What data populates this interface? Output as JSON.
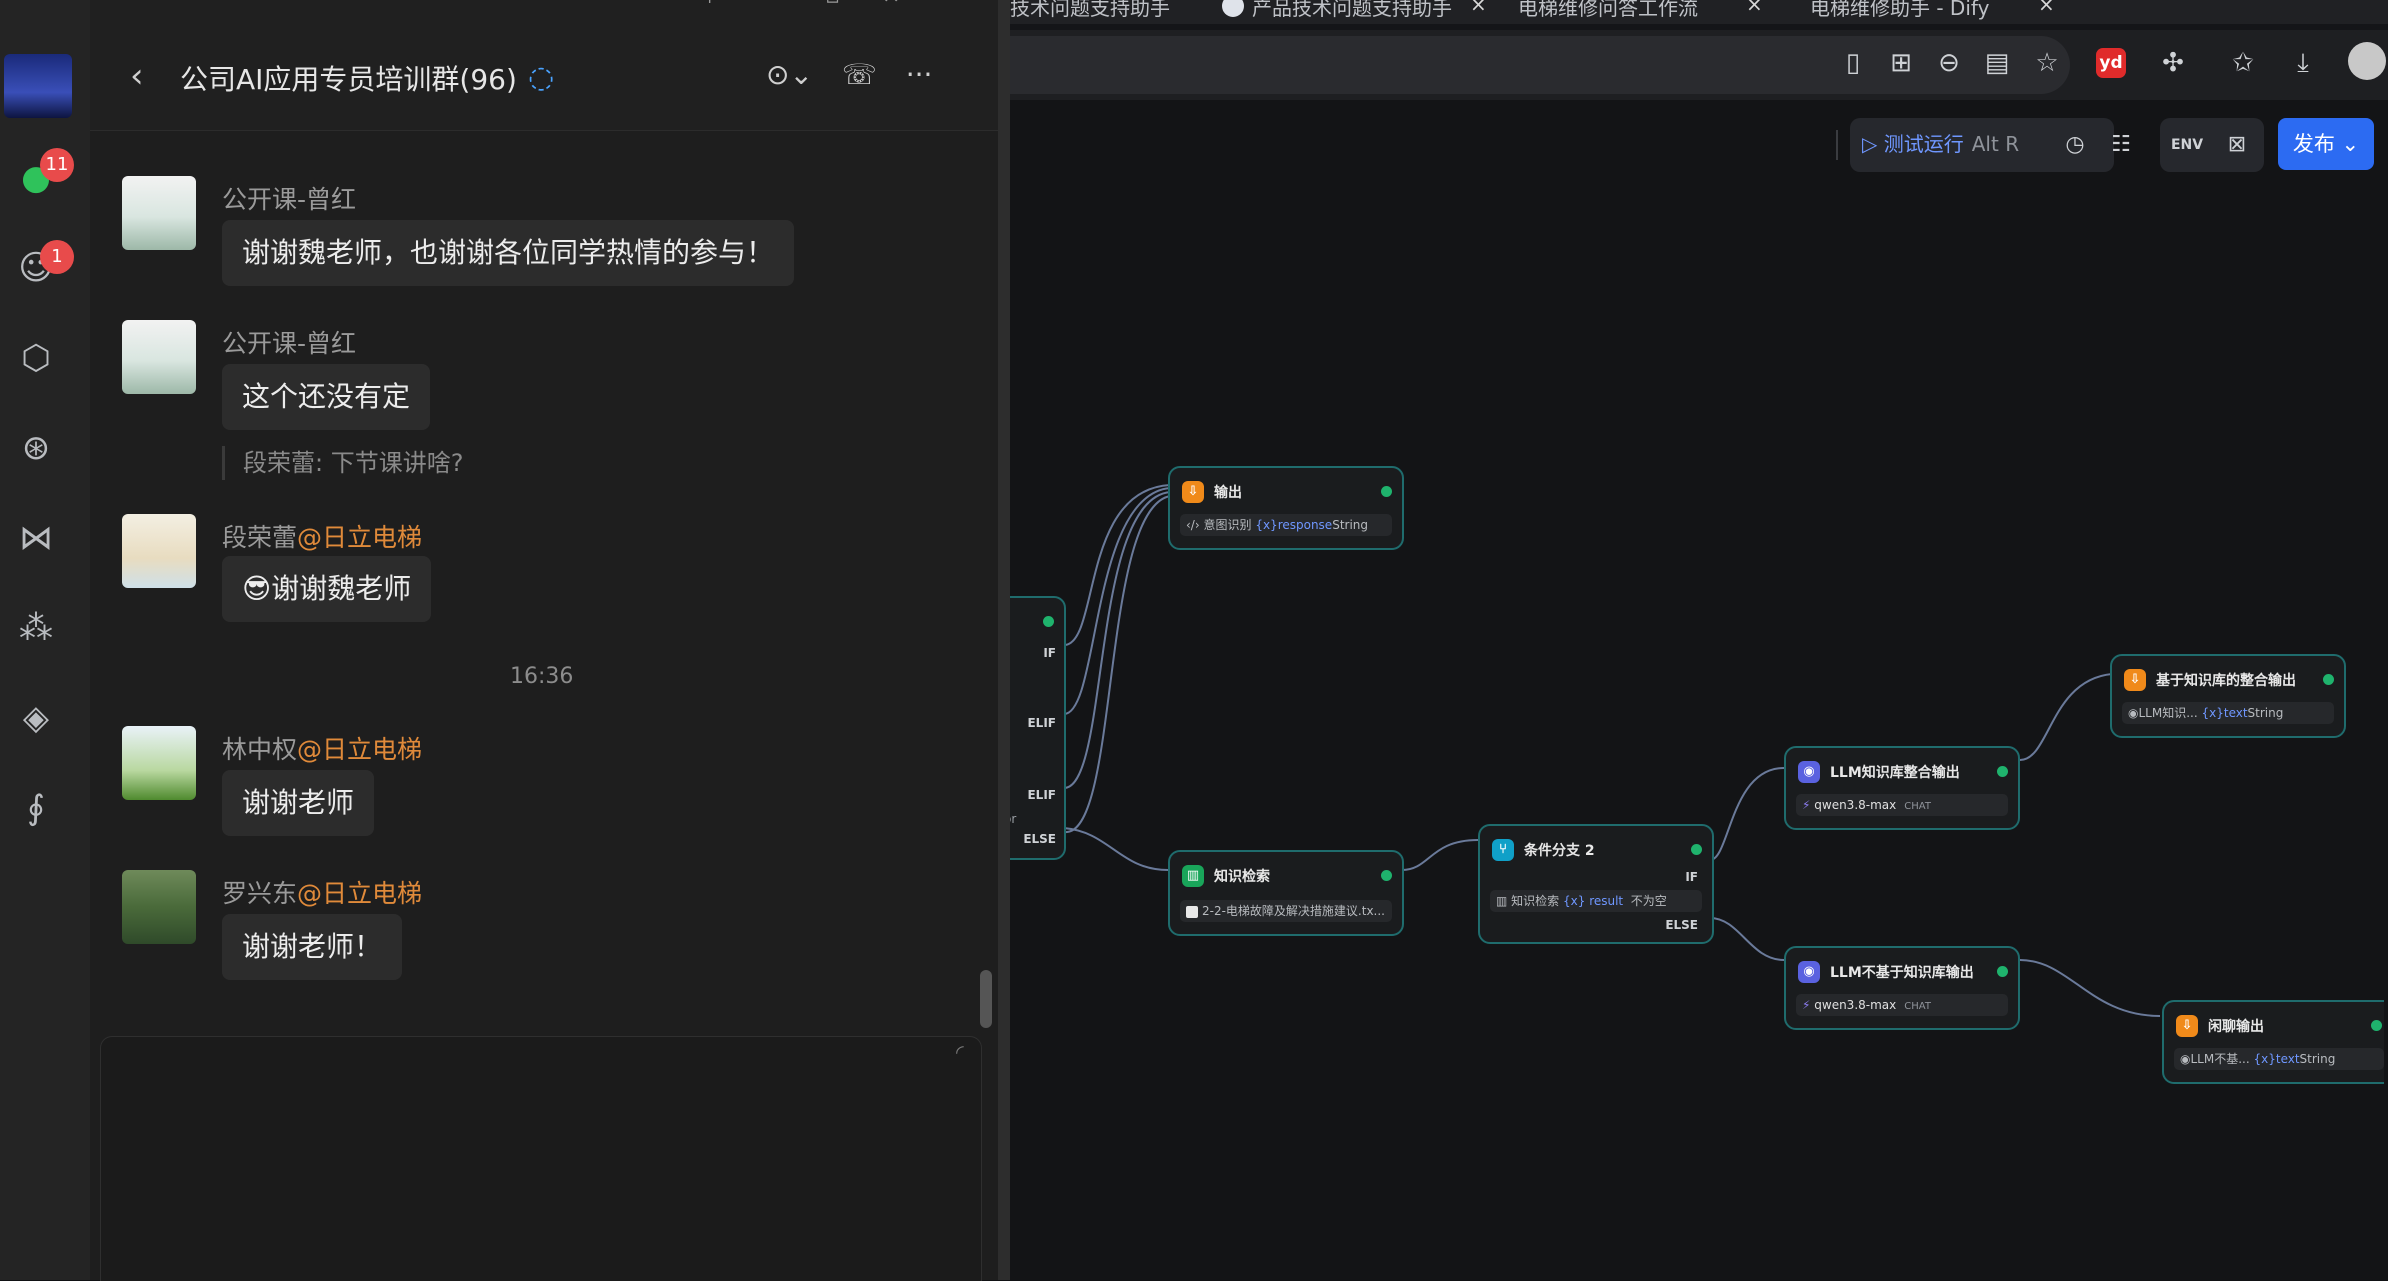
{
  "browser": {
    "tabs": [
      {
        "label": "技术问题支持助手",
        "close": "×"
      },
      {
        "label": "产品技术问题支持助手",
        "close": "×"
      },
      {
        "label": "电梯维修问答工作流",
        "close": "×"
      },
      {
        "label": "电梯维修助手 - Dify",
        "close": "×"
      }
    ],
    "toolbar_icons": [
      "clipboard-icon",
      "extensions-grid-icon",
      "zoom-out-icon",
      "reader-icon",
      "star-icon",
      "youdao-icon",
      "puzzle-icon",
      "favorites-icon",
      "download-icon",
      "account-icon"
    ],
    "youdao_label": "yd"
  },
  "workflow_toolbar": {
    "run_label": "测试运行",
    "run_shortcut": "Alt  R",
    "env_label": "ENV",
    "publish_label": "发布"
  },
  "nodes": {
    "output1": {
      "title": "输出",
      "row_prefix": "意图识别",
      "row_var": "response",
      "row_type": "String"
    },
    "branch1": {
      "labels": [
        "IF",
        "ELIF",
        "ELIF",
        "or",
        "ELSE"
      ]
    },
    "kb": {
      "title": "知识检索",
      "row": "2-2-电梯故障及解决措施建议.tx..."
    },
    "cond2": {
      "title": "条件分支 2",
      "if": "IF",
      "row_prefix": "知识检索",
      "row_var": "result",
      "row_op": "不为空",
      "else": "ELSE"
    },
    "llm_kb": {
      "title": "LLM知识库整合输出",
      "model": "qwen3.8-max",
      "tag": "CHAT"
    },
    "llm_nokb": {
      "title": "LLM不基于知识库输出",
      "model": "qwen3.8-max",
      "tag": "CHAT"
    },
    "out_kb": {
      "title": "基于知识库的整合输出",
      "row_prefix": "LLM知识...",
      "row_var": "text",
      "row_type": "String"
    },
    "out_chat": {
      "title": "闲聊输出",
      "row_prefix": "LLM不基...",
      "row_var": "text",
      "row_type": "String"
    }
  },
  "chat": {
    "title": "公司AI应用专员培训群(96)",
    "sidebar_badges": {
      "messages": "11",
      "contacts": "1"
    },
    "messages": [
      {
        "sender": "公开课-曾红",
        "sender_at": "",
        "text": "谢谢魏老师，也谢谢各位同学热情的参与！"
      },
      {
        "sender": "公开课-曾红",
        "sender_at": "",
        "text": "这个还没有定",
        "quote": "段荣蕾: 下节课讲啥?"
      },
      {
        "sender": "段荣蕾",
        "sender_at": "@日立电梯",
        "text": "😎谢谢魏老师"
      },
      {
        "sender": "林中权",
        "sender_at": "@日立电梯",
        "text": "谢谢老师"
      },
      {
        "sender": "罗兴东",
        "sender_at": "@日立电梯",
        "text": "谢谢老师！"
      }
    ],
    "time_divider": "16:36"
  }
}
